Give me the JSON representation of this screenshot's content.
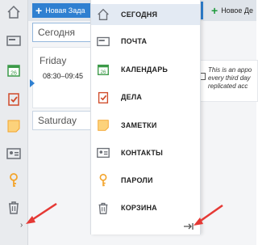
{
  "toolbar": {
    "new_task_label": "Новая Зада",
    "new_event_label": "Новое Де"
  },
  "calendar": {
    "today_label": "Сегодня",
    "friday_label": "Friday",
    "friday_time": "08:30–09:45",
    "saturday_label": "Saturday",
    "note_lines": [
      "This is an appo",
      "every third day",
      "replicated acc"
    ]
  },
  "menu": {
    "items": [
      {
        "label": "СЕГОДНЯ",
        "icon": "home-icon"
      },
      {
        "label": "ПОЧТА",
        "icon": "mail-icon"
      },
      {
        "label": "КАЛЕНДАРЬ",
        "icon": "calendar-icon"
      },
      {
        "label": "ДЕЛА",
        "icon": "tasks-icon"
      },
      {
        "label": "ЗАМЕТКИ",
        "icon": "notes-icon"
      },
      {
        "label": "КОНТАКТЫ",
        "icon": "contacts-icon"
      },
      {
        "label": "ПАРОЛИ",
        "icon": "passwords-icon"
      },
      {
        "label": "КОРЗИНА",
        "icon": "trash-icon"
      }
    ]
  },
  "rail": {
    "calendar_day": "26"
  },
  "colors": {
    "accent": "#2f80d1",
    "arrow_annotation": "#e53935"
  }
}
